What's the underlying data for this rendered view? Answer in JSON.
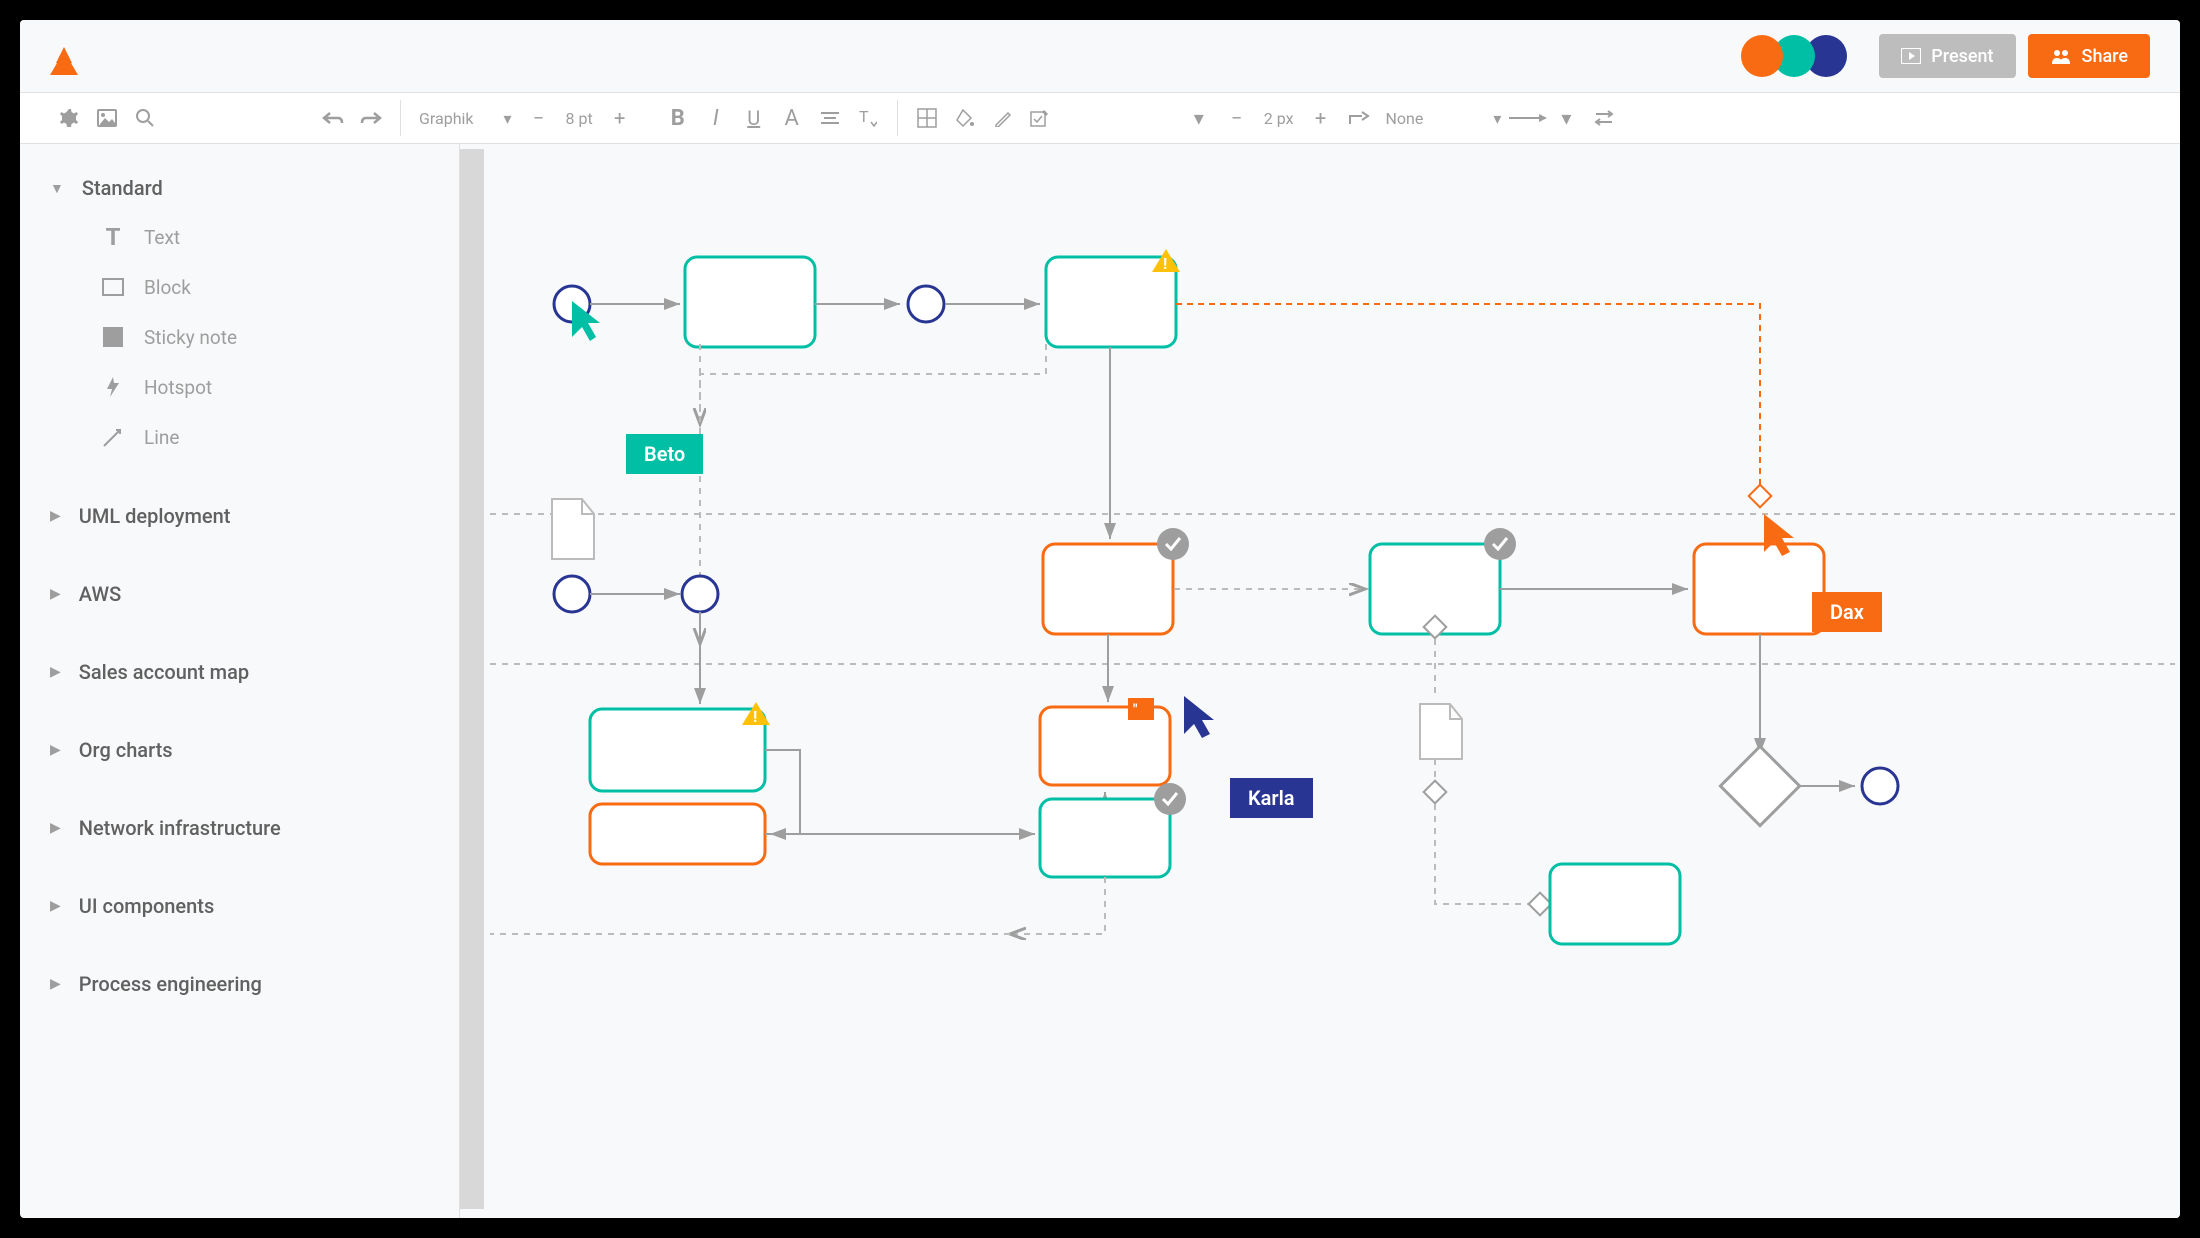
{
  "topbar": {
    "present_label": "Present",
    "share_label": "Share"
  },
  "toolbar": {
    "font": "Graphik",
    "font_size": "8 pt",
    "line_width": "2 px",
    "endpoint": "None"
  },
  "sidebar": {
    "categories": [
      {
        "label": "Standard",
        "expanded": true,
        "items": [
          {
            "label": "Text",
            "icon": "text"
          },
          {
            "label": "Block",
            "icon": "block"
          },
          {
            "label": "Sticky note",
            "icon": "sticky"
          },
          {
            "label": "Hotspot",
            "icon": "hotspot"
          },
          {
            "label": "Line",
            "icon": "line"
          }
        ]
      },
      {
        "label": "UML deployment",
        "expanded": false
      },
      {
        "label": "AWS",
        "expanded": false
      },
      {
        "label": "Sales account map",
        "expanded": false
      },
      {
        "label": "Org charts",
        "expanded": false
      },
      {
        "label": "Network infrastructure",
        "expanded": false
      },
      {
        "label": "UI components",
        "expanded": false
      },
      {
        "label": "Process engineering",
        "expanded": false
      }
    ]
  },
  "collaborators": [
    {
      "name": "Beto",
      "color": "teal"
    },
    {
      "name": "Karla",
      "color": "navy"
    },
    {
      "name": "Dax",
      "color": "orange"
    }
  ],
  "avatar_colors": [
    "#f96b13",
    "#00bfa5",
    "#283593"
  ]
}
